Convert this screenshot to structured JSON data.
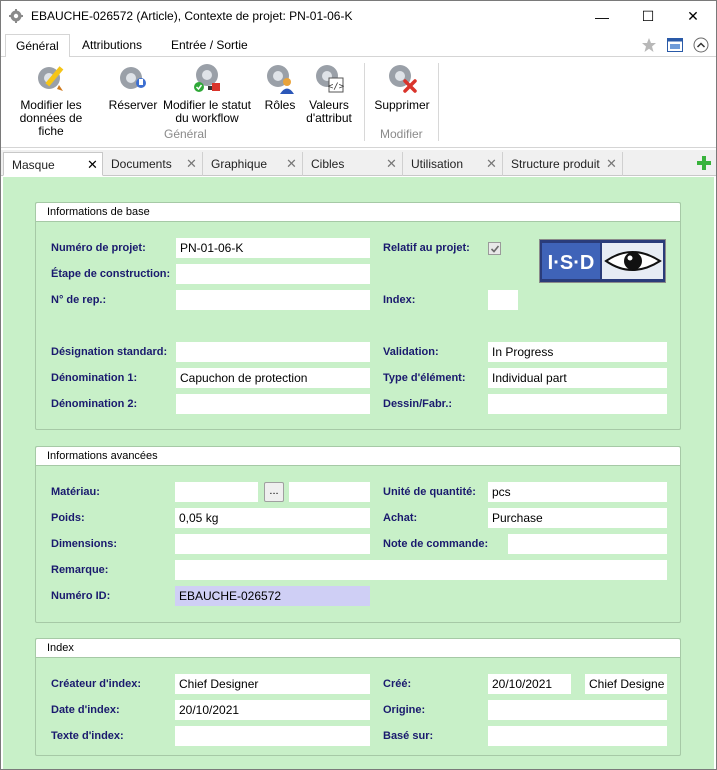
{
  "window": {
    "title": "EBAUCHE-026572 (Article), Contexte de projet: PN-01-06-K",
    "minimize_glyph": "—",
    "maximize_glyph": "☐",
    "close_glyph": "✕"
  },
  "ribbon": {
    "tabs": [
      {
        "label": "Général"
      },
      {
        "label": "Attributions"
      },
      {
        "label": "Entrée / Sortie"
      }
    ],
    "buttons": {
      "edit_sheet": "Modifier les\ndonnées de fiche",
      "reserve": "Réserver",
      "change_status": "Modifier le statut\ndu workflow",
      "roles": "Rôles",
      "attr_values": "Valeurs\nd'attribut",
      "delete": "Supprimer"
    },
    "groups": {
      "general": "Général",
      "modify": "Modifier"
    }
  },
  "doc_tabs": [
    {
      "label": "Masque"
    },
    {
      "label": "Documents"
    },
    {
      "label": "Graphique"
    },
    {
      "label": "Cibles"
    },
    {
      "label": "Utilisation"
    },
    {
      "label": "Structure produit"
    }
  ],
  "tab_close_glyph": "✕",
  "colors": {
    "form_bg": "#c8f0c8",
    "label": "#1a1a6e",
    "id_field": "#cfcff5"
  },
  "sections": {
    "base": {
      "title": "Informations de base",
      "project_no_label": "Numéro de projet:",
      "project_no": "PN-01-06-K",
      "project_related_label": "Relatif au projet:",
      "project_related_checked": true,
      "build_stage_label": "Étape de construction:",
      "build_stage": "",
      "rep_no_label": "N° de rep.:",
      "rep_no": "",
      "index_label": "Index:",
      "index": "",
      "std_designation_label": "Désignation standard:",
      "std_designation": "",
      "validation_label": "Validation:",
      "validation": "In Progress",
      "name1_label": "Dénomination 1:",
      "name1": "Capuchon de protection",
      "element_type_label": "Type d'élément:",
      "element_type": "Individual part",
      "name2_label": "Dénomination 2:",
      "name2": "",
      "drawing_label": "Dessin/Fabr.:",
      "drawing": "",
      "logo_text": "I·S·D"
    },
    "advanced": {
      "title": "Informations avancées",
      "material_label": "Matériau:",
      "material_a": "",
      "material_btn": "...",
      "material_b": "",
      "qty_unit_label": "Unité de quantité:",
      "qty_unit": "pcs",
      "weight_label": "Poids:",
      "weight": "0,05 kg",
      "purchase_label": "Achat:",
      "purchase": "Purchase",
      "dimensions_label": "Dimensions:",
      "dimensions": "",
      "order_note_label": "Note de commande:",
      "order_note": "",
      "remark_label": "Remarque:",
      "remark": "",
      "id_label": "Numéro ID:",
      "id": "EBAUCHE-026572"
    },
    "index": {
      "title": "Index",
      "creator_label": "Créateur d'index:",
      "creator": "Chief Designer",
      "created_label": "Créé:",
      "created_date": "20/10/2021",
      "created_by": "Chief Designe",
      "date_label": "Date d'index:",
      "date": "20/10/2021",
      "origin_label": "Origine:",
      "origin": "",
      "text_label": "Texte d'index:",
      "text": "",
      "based_on_label": "Basé sur:",
      "based_on": ""
    }
  }
}
